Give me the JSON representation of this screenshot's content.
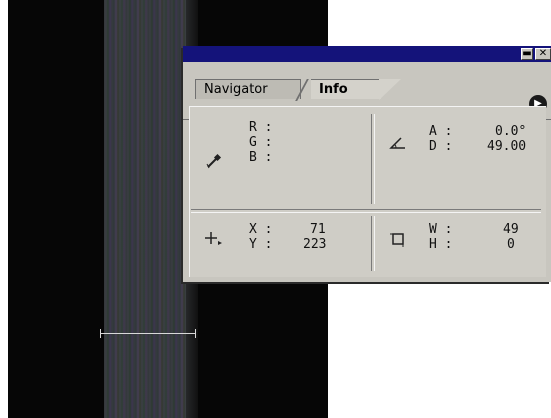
{
  "panel": {
    "tabs": [
      {
        "label": "Navigator"
      },
      {
        "label": "Info"
      }
    ],
    "color_readout": {
      "r_label": "R :",
      "g_label": "G :",
      "b_label": "B :"
    },
    "angle_readout": {
      "a_label": "A :",
      "a_value": "0.0°",
      "d_label": "D :",
      "d_value": "49.00"
    },
    "position_readout": {
      "x_label": "X :",
      "x_value": "71",
      "y_label": "Y :",
      "y_value": "223"
    },
    "size_readout": {
      "w_label": "W :",
      "w_value": "49",
      "h_label": "H :",
      "h_value": "0"
    },
    "icons": {
      "eyedropper": "eyedropper-icon",
      "angle": "angle-icon",
      "crosshair": "crosshair-icon",
      "selection": "selection-size-icon",
      "menu": "palette-menu-icon"
    }
  },
  "colors": {
    "title_bar": "#14137a",
    "panel_bg": "#c8c6bf"
  }
}
